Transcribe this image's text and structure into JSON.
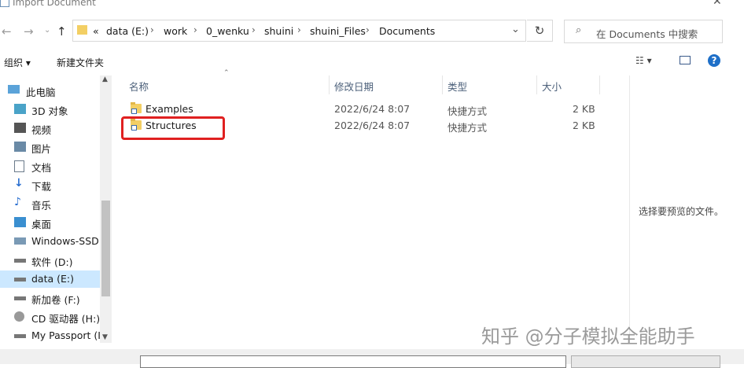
{
  "window": {
    "title": "Import Document"
  },
  "address": {
    "prefix": "«",
    "path": [
      "data (E:)",
      "work",
      "0_wenku",
      "shuini",
      "shuini_Files",
      "Documents"
    ],
    "search_placeholder": "在 Documents 中搜索"
  },
  "toolbar": {
    "organize": "组织 ▾",
    "new_folder": "新建文件夹",
    "view_icon": "view-icon ▾"
  },
  "nav": [
    {
      "label": "此电脑",
      "icon": "computer-icon"
    },
    {
      "label": "3D 对象",
      "icon": "cube-icon"
    },
    {
      "label": "视频",
      "icon": "video-icon"
    },
    {
      "label": "图片",
      "icon": "picture-icon"
    },
    {
      "label": "文档",
      "icon": "document-icon"
    },
    {
      "label": "下载",
      "icon": "download-icon"
    },
    {
      "label": "音乐",
      "icon": "music-icon"
    },
    {
      "label": "桌面",
      "icon": "desktop-icon"
    },
    {
      "label": "Windows-SSD",
      "icon": "drive-icon"
    },
    {
      "label": "软件 (D:)",
      "icon": "drive-icon"
    },
    {
      "label": "data (E:)",
      "icon": "drive-icon"
    },
    {
      "label": "新加卷 (F:)",
      "icon": "drive-icon"
    },
    {
      "label": "CD 驱动器 (H:)",
      "icon": "cd-icon"
    },
    {
      "label": "My Passport (I",
      "icon": "drive-icon"
    }
  ],
  "columns": {
    "name": "名称",
    "date": "修改日期",
    "type": "类型",
    "size": "大小"
  },
  "files": [
    {
      "name": "Examples",
      "date": "2022/6/24 8:07",
      "type": "快捷方式",
      "size": "2 KB"
    },
    {
      "name": "Structures",
      "date": "2022/6/24 8:07",
      "type": "快捷方式",
      "size": "2 KB"
    }
  ],
  "preview": {
    "message": "选择要预览的文件。"
  },
  "watermark": "知乎 @分子模拟全能助手",
  "colors": {
    "highlight": "#e02020",
    "accent": "#1e6fc8"
  }
}
